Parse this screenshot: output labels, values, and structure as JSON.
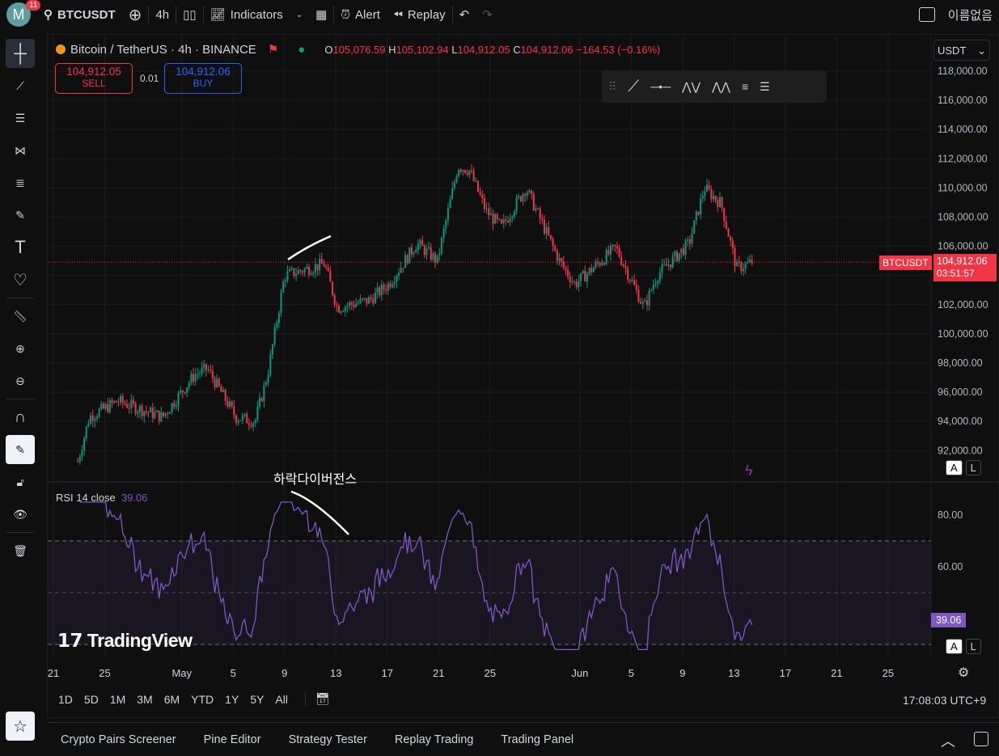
{
  "topbar": {
    "avatar_letter": "M",
    "notif_count": "11",
    "symbol": "BTCUSDT",
    "interval": "4h",
    "indicators": "Indicators",
    "alert": "Alert",
    "replay": "Replay",
    "layout_name": "이름없음"
  },
  "legend": {
    "title": "Bitcoin / TetherUS · 4h · BINANCE",
    "o_label": "O",
    "o": "105,076.59",
    "h_label": "H",
    "h": "105,102.94",
    "l_label": "L",
    "l": "104,912.05",
    "c_label": "C",
    "c": "104,912.06",
    "change": "−164.53 (−0.16%)"
  },
  "trade": {
    "sell_price": "104,912.05",
    "sell": "SELL",
    "spread": "0.01",
    "buy_price": "104,912.06",
    "buy": "BUY"
  },
  "currency": "USDT",
  "price_tag": {
    "symbol": "BTCUSDT",
    "price": "104,912.06",
    "countdown": "03:51:57"
  },
  "rsi": {
    "label": "RSI 14 close",
    "value": "39.06",
    "ticks": [
      "80.00",
      "60.00"
    ]
  },
  "annotation": "하락다이버전스",
  "watermark": "TradingView",
  "auto": "A",
  "log": "L",
  "ranges": [
    "1D",
    "5D",
    "1M",
    "3M",
    "6M",
    "YTD",
    "1Y",
    "5Y",
    "All"
  ],
  "clock": "17:08:03 UTC+9",
  "bottom_tabs": [
    "Crypto Pairs Screener",
    "Pine Editor",
    "Strategy Tester",
    "Replay Trading",
    "Trading Panel"
  ],
  "colors": {
    "up": "#089981",
    "down": "#f23645",
    "rsi": "#7e57c2",
    "bg": "#0f0f0f"
  },
  "chart_data": {
    "type": "candlestick",
    "price_ticks": [
      "118,000.00",
      "116,000.00",
      "114,000.00",
      "112,000.00",
      "110,000.00",
      "108,000.00",
      "106,000.00",
      "104,000.00",
      "102,000.00",
      "100,000.00",
      "98,000.00",
      "96,000.00",
      "94,000.00",
      "92,000.00"
    ],
    "price_range": [
      91500,
      118500
    ],
    "date_ticks": [
      "21",
      "25",
      "May",
      "5",
      "9",
      "13",
      "17",
      "21",
      "25",
      "Jun",
      "5",
      "9",
      "13",
      "17",
      "21",
      "25"
    ],
    "close_waypoints_days_from_apr21": [
      [
        1.9,
        91250
      ],
      [
        2.8,
        94300
      ],
      [
        5,
        95400
      ],
      [
        8.5,
        94300
      ],
      [
        11,
        97200
      ],
      [
        12,
        97600
      ],
      [
        14.2,
        94300
      ],
      [
        15.7,
        94000
      ],
      [
        16.7,
        97300
      ],
      [
        18,
        104000
      ],
      [
        21.1,
        104800
      ],
      [
        22.1,
        101800
      ],
      [
        24.6,
        102300
      ],
      [
        26.1,
        103400
      ],
      [
        28.3,
        106200
      ],
      [
        29.9,
        105000
      ],
      [
        31.5,
        111500
      ],
      [
        32.4,
        111200
      ],
      [
        33.7,
        108400
      ],
      [
        34.9,
        107300
      ],
      [
        36.8,
        110000
      ],
      [
        39.4,
        105000
      ],
      [
        40.6,
        103400
      ],
      [
        43.8,
        105900
      ],
      [
        46,
        101800
      ],
      [
        47,
        104000
      ],
      [
        49.5,
        106200
      ],
      [
        50.7,
        110000
      ],
      [
        52,
        108900
      ],
      [
        53.2,
        104500
      ],
      [
        54.5,
        104912
      ]
    ],
    "current_price": 104912.06,
    "rsi_levels": [
      70,
      50,
      30
    ]
  }
}
